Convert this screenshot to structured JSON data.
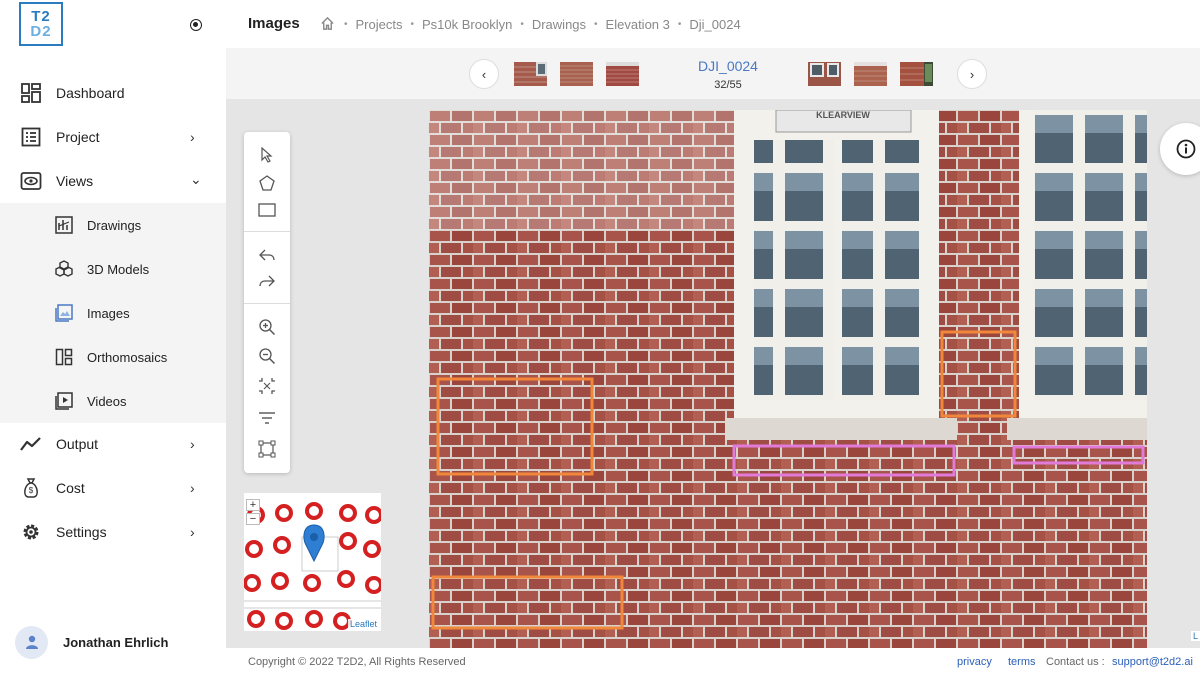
{
  "logo": {
    "line1": "T2",
    "line2": "D2"
  },
  "sidebar": {
    "items": [
      {
        "label": "Dashboard",
        "icon": "dashboard-icon"
      },
      {
        "label": "Project",
        "icon": "project-icon",
        "chevron": "›"
      },
      {
        "label": "Views",
        "icon": "eye-icon",
        "chevron": "⌄"
      },
      {
        "label": "Output",
        "icon": "chart-line-icon",
        "chevron": "›"
      },
      {
        "label": "Cost",
        "icon": "money-bag-icon",
        "chevron": "›"
      },
      {
        "label": "Settings",
        "icon": "gear-icon",
        "chevron": "›"
      }
    ],
    "views_children": [
      {
        "label": "Drawings",
        "icon": "drawing-icon"
      },
      {
        "label": "3D Models",
        "icon": "cubes-icon"
      },
      {
        "label": "Images",
        "icon": "image-icon"
      },
      {
        "label": "Orthomosaics",
        "icon": "orthomosaic-icon"
      },
      {
        "label": "Videos",
        "icon": "video-icon"
      }
    ],
    "user_name": "Jonathan Ehrlich"
  },
  "header": {
    "title": "Images",
    "breadcrumb": [
      "Projects",
      "Ps10k Brooklyn",
      "Drawings",
      "Elevation 3",
      "Dji_0024"
    ],
    "separator": "•"
  },
  "strip": {
    "prev": "‹",
    "next": "›",
    "image_name": "DJI_0024",
    "position": "32/55"
  },
  "viewer": {
    "sign_text": "KLEARVIEW",
    "minimap": {
      "zoom_in": "+",
      "zoom_out": "−",
      "attribution": "Leaflet",
      "edge_label": "L"
    },
    "annotation_colors": {
      "orange": "#f0873a",
      "pink": "#e27ad9"
    }
  },
  "footer": {
    "copyright": "Copyright © 2022 T2D2, All Rights Reserved",
    "privacy": "privacy",
    "terms": "terms",
    "contact_label": "Contact us :",
    "contact_email": "support@t2d2.ai"
  }
}
